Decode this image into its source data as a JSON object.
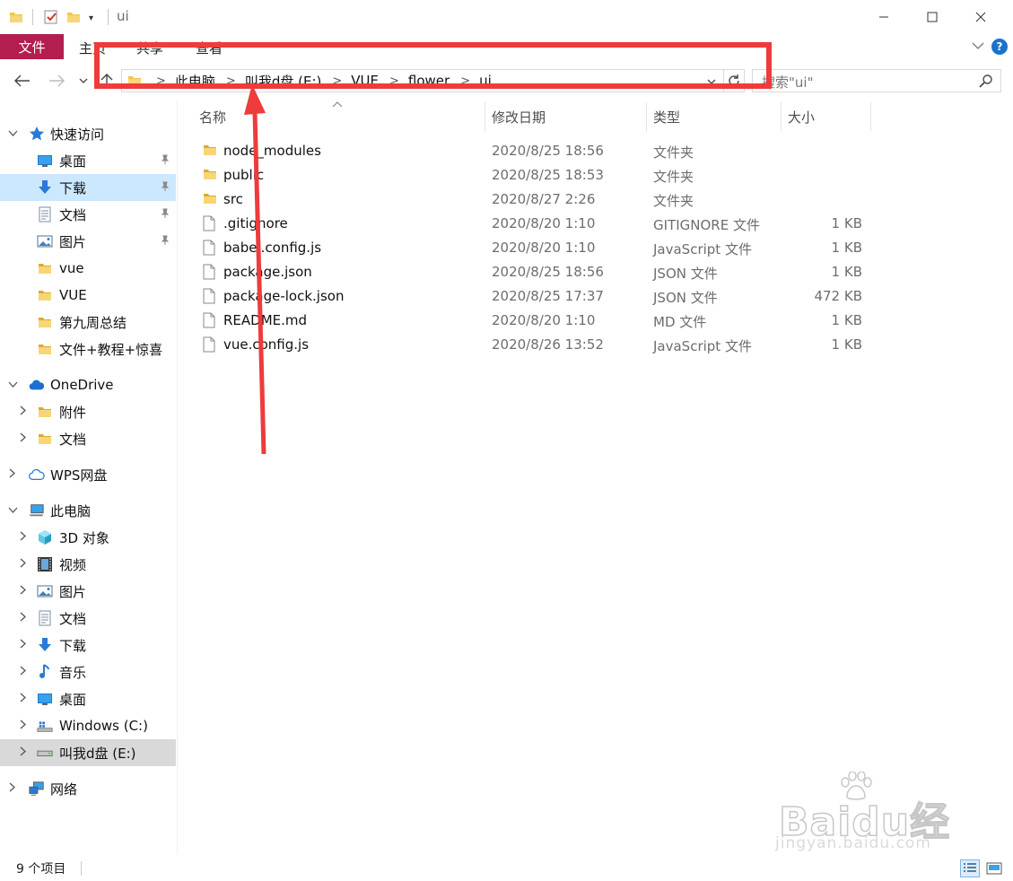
{
  "window": {
    "title": "ui",
    "controls": {
      "minimize": "minimize",
      "maximize": "maximize",
      "close": "close"
    }
  },
  "ribbon": {
    "file": "文件",
    "tabs": [
      "主页",
      "共享",
      "查看"
    ]
  },
  "nav": {
    "breadcrumb": [
      "此电脑",
      "叫我d盘 (E:)",
      "VUE",
      "flower",
      "ui"
    ],
    "search_placeholder": "搜索\"ui\""
  },
  "sidebar": {
    "quick_access": {
      "label": "快速访问",
      "items": [
        {
          "label": "桌面",
          "icon": "desktop-icon",
          "pinned": true
        },
        {
          "label": "下载",
          "icon": "download-icon",
          "pinned": true,
          "selected": true
        },
        {
          "label": "文档",
          "icon": "document-icon",
          "pinned": true
        },
        {
          "label": "图片",
          "icon": "picture-icon",
          "pinned": true
        },
        {
          "label": "vue",
          "icon": "folder-icon"
        },
        {
          "label": "VUE",
          "icon": "folder-icon"
        },
        {
          "label": "第九周总结",
          "icon": "folder-icon"
        },
        {
          "label": "文件+教程+惊喜",
          "icon": "folder-icon"
        }
      ]
    },
    "onedrive": {
      "label": "OneDrive",
      "items": [
        {
          "label": "附件",
          "icon": "folder-icon"
        },
        {
          "label": "文档",
          "icon": "folder-icon"
        }
      ]
    },
    "wps": {
      "label": "WPS网盘"
    },
    "this_pc": {
      "label": "此电脑",
      "items": [
        {
          "label": "3D 对象",
          "icon": "3d-objects-icon"
        },
        {
          "label": "视频",
          "icon": "video-icon"
        },
        {
          "label": "图片",
          "icon": "picture-icon"
        },
        {
          "label": "文档",
          "icon": "document-icon"
        },
        {
          "label": "下载",
          "icon": "download-icon"
        },
        {
          "label": "音乐",
          "icon": "music-icon"
        },
        {
          "label": "桌面",
          "icon": "desktop-icon"
        },
        {
          "label": "Windows (C:)",
          "icon": "windows-drive-icon"
        },
        {
          "label": "叫我d盘 (E:)",
          "icon": "drive-icon",
          "selected": true
        }
      ]
    },
    "network": {
      "label": "网络"
    }
  },
  "columns": {
    "name": "名称",
    "date": "修改日期",
    "type": "类型",
    "size": "大小"
  },
  "files": [
    {
      "name": "node_modules",
      "date": "2020/8/25 18:56",
      "type": "文件夹",
      "size": "",
      "kind": "folder"
    },
    {
      "name": "public",
      "date": "2020/8/25 18:53",
      "type": "文件夹",
      "size": "",
      "kind": "folder"
    },
    {
      "name": "src",
      "date": "2020/8/27 2:26",
      "type": "文件夹",
      "size": "",
      "kind": "folder"
    },
    {
      "name": ".gitignore",
      "date": "2020/8/20 1:10",
      "type": "GITIGNORE 文件",
      "size": "1 KB",
      "kind": "file"
    },
    {
      "name": "babel.config.js",
      "date": "2020/8/20 1:10",
      "type": "JavaScript 文件",
      "size": "1 KB",
      "kind": "file"
    },
    {
      "name": "package.json",
      "date": "2020/8/25 18:56",
      "type": "JSON 文件",
      "size": "1 KB",
      "kind": "file"
    },
    {
      "name": "package-lock.json",
      "date": "2020/8/25 17:37",
      "type": "JSON 文件",
      "size": "472 KB",
      "kind": "file"
    },
    {
      "name": "README.md",
      "date": "2020/8/20 1:10",
      "type": "MD 文件",
      "size": "1 KB",
      "kind": "file"
    },
    {
      "name": "vue.config.js",
      "date": "2020/8/26 13:52",
      "type": "JavaScript 文件",
      "size": "1 KB",
      "kind": "file"
    }
  ],
  "status": {
    "count": "9 个项目"
  },
  "watermark": {
    "brand": "Baidu经验",
    "url": "jingyan.baidu.com"
  },
  "colors": {
    "file_tab": "#b31e4f",
    "selection": "#cce8ff",
    "annotation": "#ee3b3b",
    "folder": "#f3c44c"
  }
}
